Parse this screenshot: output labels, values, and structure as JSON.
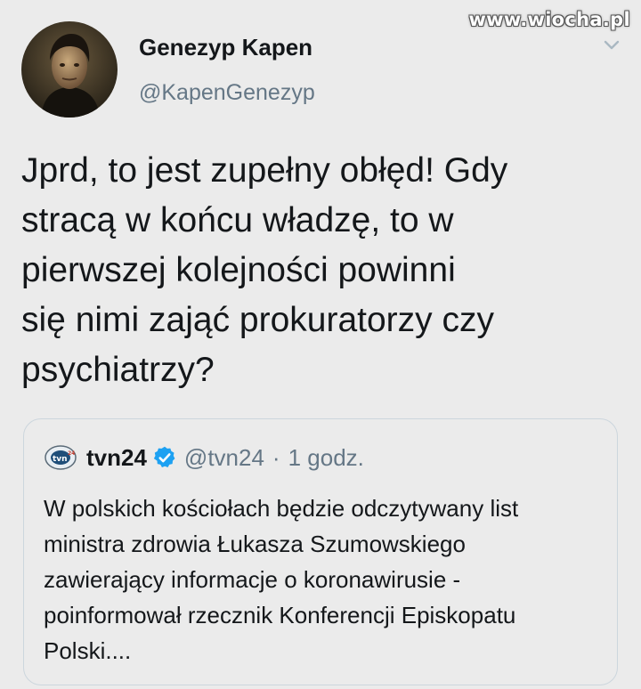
{
  "watermark": "www.wiocha.pl",
  "author": {
    "name": "Genezyp Kapen",
    "handle": "@KapenGenezyp",
    "avatar_icon": "person-portrait-avatar"
  },
  "tweet": {
    "text": "Jprd, to jest zupełny obłęd! Gdy\nstracą w końcu władzę, to w\npierwszej kolejności powinni\nsię nimi zająć prokuratorzy czy\npsychiatrzy?"
  },
  "menu": {
    "icon": "chevron-down-icon"
  },
  "quoted_tweet": {
    "logo_icon": "tvn24-logo-icon",
    "name": "tvn24",
    "verified_icon": "verified-badge-icon",
    "handle": "@tvn24",
    "separator": "·",
    "time": "1 godz.",
    "text": "W polskich kościołach będzie odczytywany list\nministra zdrowia Łukasza Szumowskiego\nzawierający informacje o koronawirusie -\npoinformował rzecznik Konferencji Episkopatu\nPolski...."
  },
  "colors": {
    "background": "#ebebeb",
    "text": "#14171a",
    "secondary": "#657786",
    "verified": "#1da1f2",
    "border": "#ccd6dd"
  }
}
